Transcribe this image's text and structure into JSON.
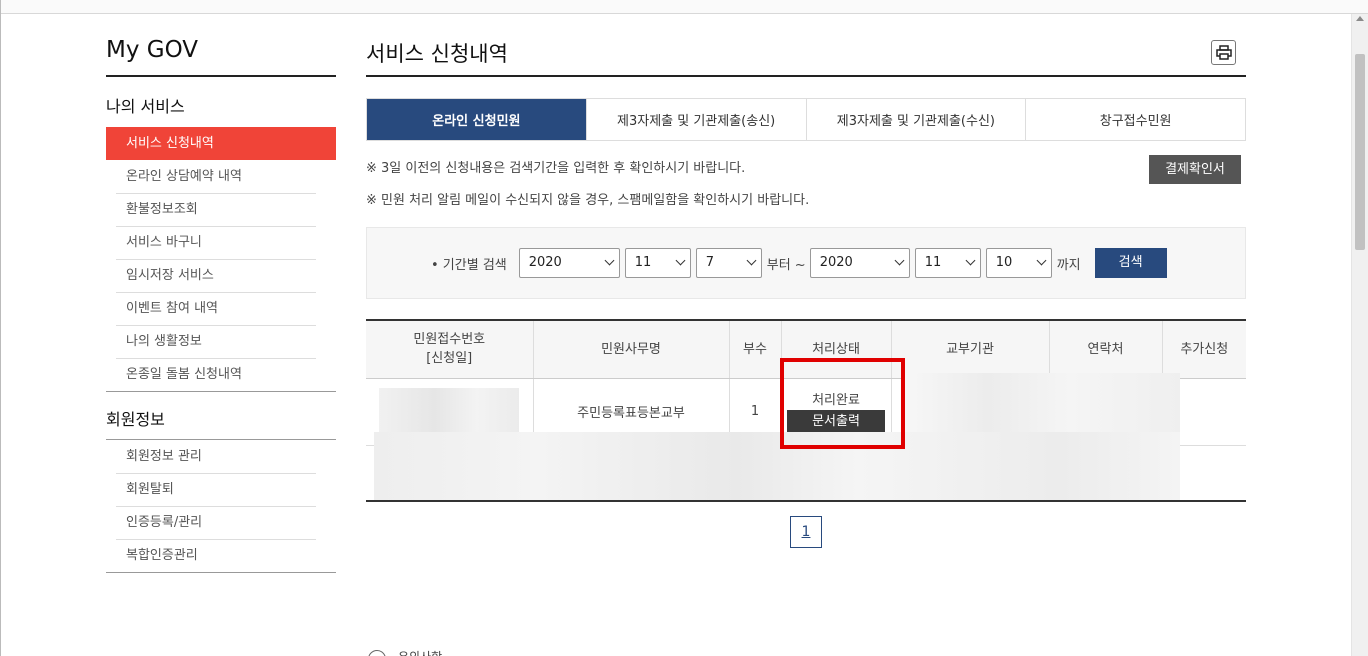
{
  "sidebar": {
    "brand": "My GOV",
    "my_services_title": "나의 서비스",
    "my_services": [
      {
        "label": "서비스 신청내역",
        "active": true
      },
      {
        "label": "온라인 상담예약 내역"
      },
      {
        "label": "환불정보조회"
      },
      {
        "label": "서비스 바구니"
      },
      {
        "label": "임시저장 서비스"
      },
      {
        "label": "이벤트 참여 내역"
      },
      {
        "label": "나의 생활정보"
      },
      {
        "label": "온종일 돌봄 신청내역"
      }
    ],
    "member_title": "회원정보",
    "member_items": [
      {
        "label": "회원정보 관리"
      },
      {
        "label": "회원탈퇴"
      },
      {
        "label": "인증등록/관리"
      },
      {
        "label": "복합인증관리"
      }
    ]
  },
  "main": {
    "title": "서비스 신청내역",
    "print_icon": "printer-icon",
    "tabs": [
      {
        "label": "온라인 신청민원",
        "active": true
      },
      {
        "label": "제3자제출 및 기관제출(송신)"
      },
      {
        "label": "제3자제출 및 기관제출(수신)"
      },
      {
        "label": "창구접수민원"
      }
    ],
    "notice1": "※ 3일 이전의 신청내용은 검색기간을 입력한 후 확인하시기 바랍니다.",
    "notice2": "※ 민원 처리 알림 메일이 수신되지 않을 경우, 스팸메일함을 확인하시기 바랍니다.",
    "payment_button": "결제확인서",
    "search": {
      "label": "• 기간별 검색",
      "from_year": "2020",
      "from_month": "11",
      "from_day": "7",
      "from_suffix": "부터 ~",
      "to_year": "2020",
      "to_month": "11",
      "to_day": "10",
      "to_suffix": "까지",
      "button": "검색"
    },
    "table": {
      "headers": {
        "receipt_no": "민원접수번호",
        "receipt_date": "[신청일]",
        "service_name": "민원사무명",
        "copies": "부수",
        "status": "처리상태",
        "agency": "교부기관",
        "contact": "연락처",
        "extra": "추가신청"
      },
      "rows": [
        {
          "service_name": "주민등록표등본교부",
          "copies": "1",
          "status": "처리완료",
          "doc_button": "문서출력"
        }
      ]
    },
    "pagination": {
      "current": "1"
    },
    "footer_peek": "유의사항"
  },
  "colors": {
    "accent_red": "#f04438",
    "navy": "#284a7e",
    "highlight_border": "#e00000"
  }
}
